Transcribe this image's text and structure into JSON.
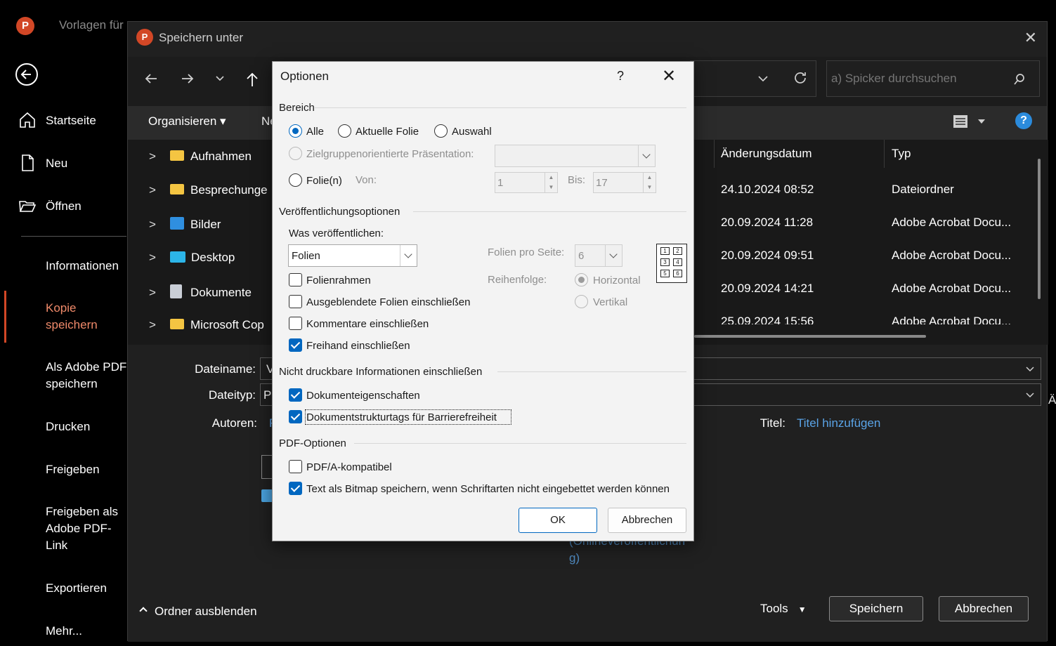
{
  "backstage": {
    "app_logo": "P",
    "bg_title": "Vorlagen für",
    "items": [
      {
        "label": "Startseite"
      },
      {
        "label": "Neu"
      },
      {
        "label": "Öffnen"
      },
      {
        "label": "Informationen"
      },
      {
        "label": "Kopie speichern"
      },
      {
        "label": "Als Adobe PDF speichern"
      },
      {
        "label": "Drucken"
      },
      {
        "label": "Freigeben"
      },
      {
        "label": "Freigeben als Adobe PDF-Link"
      },
      {
        "label": "Exportieren"
      },
      {
        "label": "Mehr..."
      }
    ],
    "accent_color": "#d24726"
  },
  "saveas": {
    "title": "Speichern unter",
    "close_glyph": "✕",
    "search_placeholder": "a) Spicker durchsuchen",
    "organize_label": "Organisieren ▾",
    "new_label_partial": "Ne",
    "help_glyph": "?",
    "tree": [
      "Aufnahmen",
      "Besprechunge",
      "Bilder",
      "Desktop",
      "Dokumente",
      "Microsoft Cop"
    ],
    "columns": {
      "modified": "Änderungsdatum",
      "type": "Typ"
    },
    "rows": [
      {
        "date": "24.10.2024 08:52",
        "type": "Dateiordner"
      },
      {
        "date": "20.09.2024 11:28",
        "type": "Adobe Acrobat Docu..."
      },
      {
        "date": "20.09.2024 09:51",
        "type": "Adobe Acrobat Docu..."
      },
      {
        "date": "20.09.2024 14:21",
        "type": "Adobe Acrobat Docu..."
      },
      {
        "date": "25.09.2024 15:56",
        "type": "Adobe Acrobat Docu..."
      }
    ],
    "filename_label": "Dateiname:",
    "filename_value": "V",
    "filetype_label": "Dateityp:",
    "filetype_value": "P",
    "authors_label": "Autoren:",
    "authors_value": "F",
    "title_label": "Titel:",
    "title_link": "Titel hinzufügen",
    "online_link_1": "(Onlineveröffentlichun",
    "online_link_2": "g)",
    "hide_folders": "Ordner ausblenden",
    "tools_label": "Tools",
    "save_label": "Speichern",
    "cancel_label": "Abbrechen"
  },
  "options": {
    "title": "Optionen",
    "help_glyph": "?",
    "close_glyph": "✕",
    "range": {
      "header": "Bereich",
      "all": "Alle",
      "current": "Aktuelle Folie",
      "selection": "Auswahl",
      "custom_show": "Zielgruppenorientierte Präsentation:",
      "slides": "Folie(n)",
      "from_label": "Von:",
      "from_value": "1",
      "to_label": "Bis:",
      "to_value": "17",
      "selected": "all"
    },
    "publish": {
      "header": "Veröffentlichungsoptionen",
      "what_label": "Was veröffentlichen:",
      "what_value": "Folien",
      "per_page_label": "Folien pro Seite:",
      "per_page_value": "6",
      "order_label": "Reihenfolge:",
      "horizontal": "Horizontal",
      "vertical": "Vertikal",
      "frame": {
        "label": "Folienrahmen",
        "checked": false
      },
      "hidden": {
        "label": "Ausgeblendete Folien einschließen",
        "checked": false
      },
      "comments": {
        "label": "Kommentare einschließen",
        "checked": false
      },
      "ink": {
        "label": "Freihand einschließen",
        "checked": true
      },
      "thumb_numbers": [
        "1",
        "2",
        "3",
        "4",
        "5",
        "6"
      ]
    },
    "nonprint": {
      "header": "Nicht druckbare Informationen einschließen",
      "doc_props": {
        "label": "Dokumenteigenschaften",
        "checked": true
      },
      "struct_tags": {
        "label": "Dokumentstrukturtags für Barrierefreiheit",
        "checked": true
      }
    },
    "pdf": {
      "header": "PDF-Optionen",
      "pdfa": {
        "label": "PDF/A-kompatibel",
        "checked": false
      },
      "bitmap": {
        "label": "Text als Bitmap speichern, wenn Schriftarten nicht eingebettet werden können",
        "checked": true
      }
    },
    "ok_label": "OK",
    "cancel_label": "Abbrechen",
    "accent_color": "#0067c0"
  }
}
